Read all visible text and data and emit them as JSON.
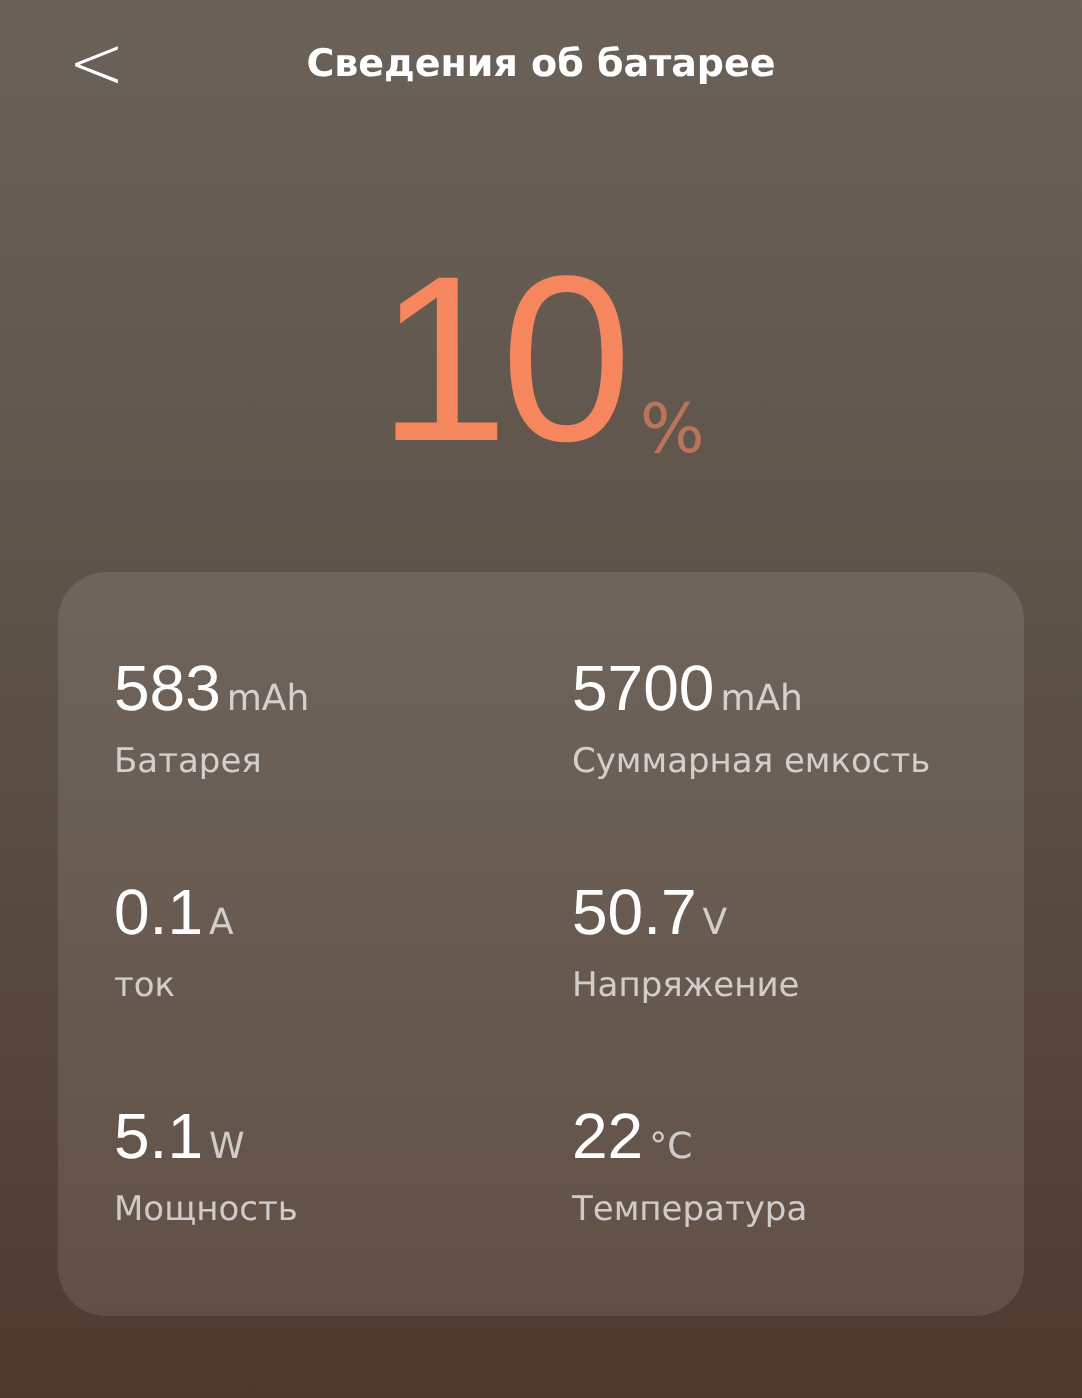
{
  "header": {
    "back_icon": "<",
    "title": "Сведения об батарее"
  },
  "charge": {
    "value": "10",
    "unit": "%"
  },
  "stats": [
    {
      "value": "583",
      "unit": "mAh",
      "label": "Батарея"
    },
    {
      "value": "5700",
      "unit": "mAh",
      "label": "Суммарная емкость"
    },
    {
      "value": "0.1",
      "unit": "A",
      "label": "ток"
    },
    {
      "value": "50.7",
      "unit": "V",
      "label": "Напряжение"
    },
    {
      "value": "5.1",
      "unit": "W",
      "label": "Мощность"
    },
    {
      "value": "22",
      "unit": "°C",
      "label": "Температура"
    }
  ]
}
